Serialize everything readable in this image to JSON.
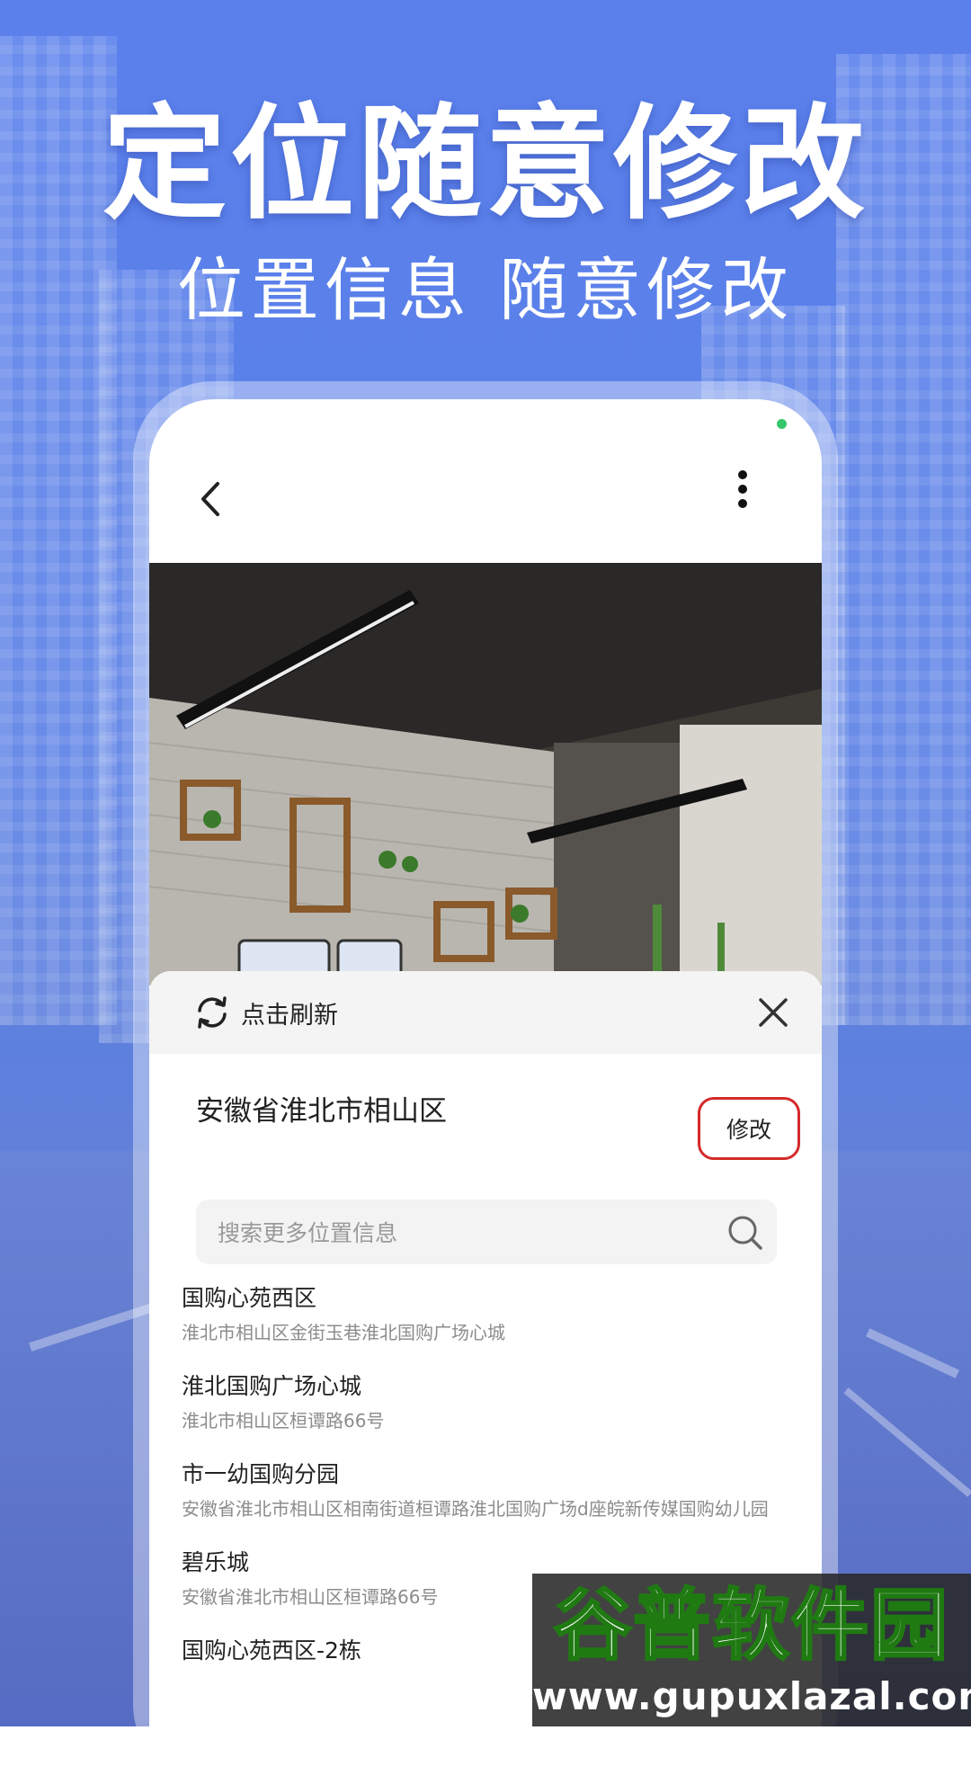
{
  "headline": "定位随意修改",
  "subline": "位置信息 随意修改",
  "sheet": {
    "refresh_label": "点击刷新",
    "current_address": "安徽省淮北市相山区",
    "edit_label": "修改",
    "search_placeholder": "搜索更多位置信息",
    "locations": [
      {
        "title": "国购心苑西区",
        "address": "淮北市相山区金街玉巷淮北国购广场心城"
      },
      {
        "title": "淮北国购广场心城",
        "address": "淮北市相山区桓谭路66号"
      },
      {
        "title": "市一幼国购分园",
        "address": "安徽省淮北市相山区相南街道桓谭路淮北国购广场d座皖新传媒国购幼儿园"
      },
      {
        "title": "碧乐城",
        "address": "安徽省淮北市相山区桓谭路66号"
      },
      {
        "title": "国购心苑西区-2栋",
        "address": ""
      }
    ]
  },
  "watermark": {
    "title": "谷普软件园",
    "url": "www.gupuxlazal.com"
  },
  "colors": {
    "background": "#5b80ec",
    "edit_border": "#d42a2a",
    "status_dot": "#35c76b"
  },
  "icons": [
    "back-arrow-icon",
    "more-vertical-icon",
    "refresh-icon",
    "close-icon",
    "search-icon"
  ]
}
